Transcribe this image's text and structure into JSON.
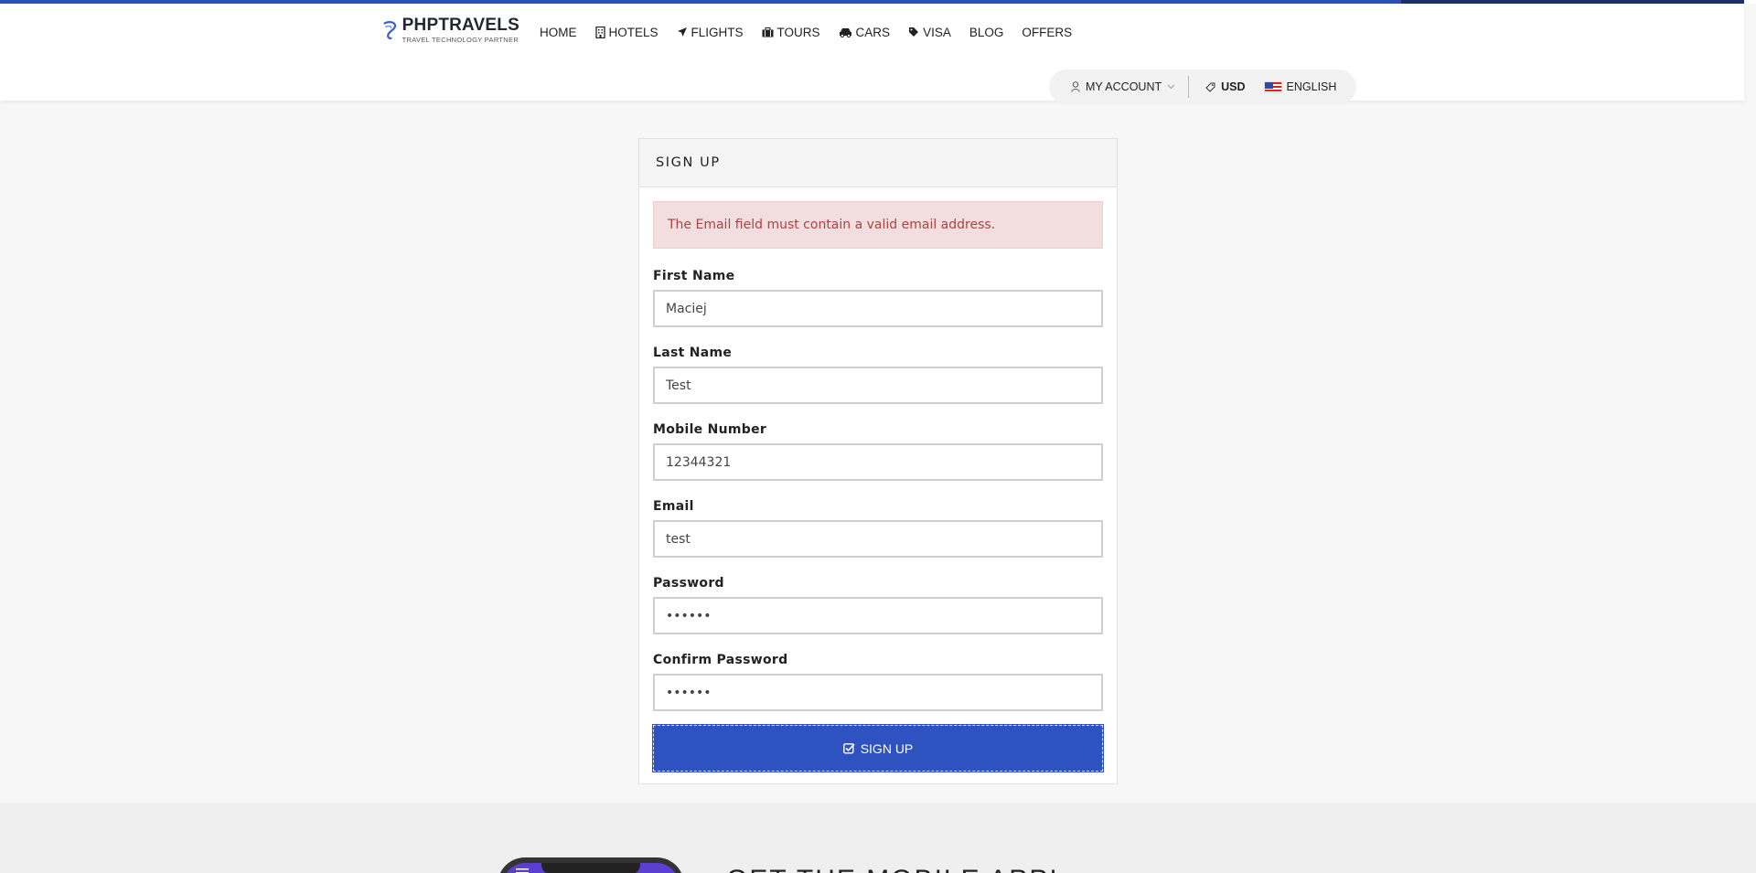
{
  "brand": {
    "name": "PHPTRAVELS",
    "tagline": "TRAVEL TECHNOLOGY PARTNER"
  },
  "nav": {
    "items": [
      {
        "label": "HOME",
        "icon": ""
      },
      {
        "label": "HOTELS",
        "icon": "building-icon"
      },
      {
        "label": "FLIGHTS",
        "icon": "plane-icon"
      },
      {
        "label": "TOURS",
        "icon": "suitcase-icon"
      },
      {
        "label": "CARS",
        "icon": "car-icon"
      },
      {
        "label": "VISA",
        "icon": "tag-icon"
      },
      {
        "label": "BLOG",
        "icon": ""
      },
      {
        "label": "OFFERS",
        "icon": ""
      }
    ]
  },
  "account": {
    "my_account": "MY ACCOUNT",
    "currency": "USD",
    "language": "ENGLISH"
  },
  "signup": {
    "title": "SIGN UP",
    "error": "The Email field must contain a valid email address.",
    "fields": {
      "first_name": {
        "label": "First Name",
        "value": "Maciej"
      },
      "last_name": {
        "label": "Last Name",
        "value": "Test"
      },
      "mobile": {
        "label": "Mobile Number",
        "value": "12344321"
      },
      "email": {
        "label": "Email",
        "value": "test"
      },
      "password": {
        "label": "Password",
        "value": "••••••"
      },
      "confirm_password": {
        "label": "Confirm Password",
        "value": "••••••"
      }
    },
    "submit": "SIGN UP"
  },
  "footer": {
    "app_heading": "GET THE MOBILE APP!"
  },
  "colors": {
    "primary": "#2e52c0",
    "alert_bg": "#f2dede",
    "alert_text": "#a94442"
  }
}
